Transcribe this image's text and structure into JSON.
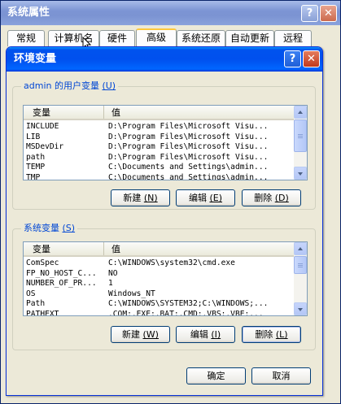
{
  "back_window": {
    "title": "系统属性",
    "help_label": "?",
    "close_label": "✕",
    "tabs": [
      "常规",
      "计算机名",
      "硬件",
      "高级",
      "系统还原",
      "自动更新",
      "远程"
    ],
    "active_tab": "高级"
  },
  "dialog": {
    "title": "环境变量",
    "help_label": "?",
    "close_label": "✕",
    "user_vars": {
      "legend": "admin 的用户变量",
      "legend_key": "(U)",
      "columns": [
        "变量",
        "值"
      ],
      "rows": [
        {
          "name": "INCLUDE",
          "value": "D:\\Program Files\\Microsoft Visu..."
        },
        {
          "name": "LIB",
          "value": "D:\\Program Files\\Microsoft Visu..."
        },
        {
          "name": "MSDevDir",
          "value": "D:\\Program Files\\Microsoft Visu..."
        },
        {
          "name": "path",
          "value": "D:\\Program Files\\Microsoft Visu..."
        },
        {
          "name": "TEMP",
          "value": "C:\\Documents and Settings\\admin..."
        },
        {
          "name": "TMP",
          "value": "C:\\Documents and Settings\\admin..."
        }
      ],
      "buttons": {
        "new": {
          "label": "新建",
          "key": "(N)"
        },
        "edit": {
          "label": "编辑",
          "key": "(E)"
        },
        "delete": {
          "label": "删除",
          "key": "(D)"
        }
      }
    },
    "system_vars": {
      "legend": "系统变量",
      "legend_key": "(S)",
      "columns": [
        "变量",
        "值"
      ],
      "rows": [
        {
          "name": "ComSpec",
          "value": "C:\\WINDOWS\\system32\\cmd.exe"
        },
        {
          "name": "FP_NO_HOST_C...",
          "value": "NO"
        },
        {
          "name": "NUMBER_OF_PR...",
          "value": "1"
        },
        {
          "name": "OS",
          "value": "Windows_NT"
        },
        {
          "name": "Path",
          "value": "C:\\WINDOWS\\SYSTEM32;C:\\WINDOWS;..."
        },
        {
          "name": "PATHEXT",
          "value": ".COM;.EXE;.BAT;.CMD;.VBS;.VBE;..."
        }
      ],
      "buttons": {
        "new": {
          "label": "新建",
          "key": "(W)"
        },
        "edit": {
          "label": "编辑",
          "key": "(I)"
        },
        "delete": {
          "label": "删除",
          "key": "(L)"
        }
      }
    },
    "ok_label": "确定",
    "cancel_label": "取消"
  }
}
